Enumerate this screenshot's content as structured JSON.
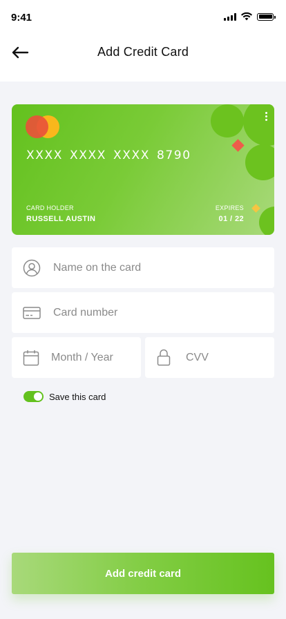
{
  "status_bar": {
    "time": "9:41"
  },
  "header": {
    "title": "Add Credit Card",
    "back_icon": "arrow-left-icon"
  },
  "card": {
    "number": "XXXX XXXX XXXX 8790",
    "holder_label": "CARD HOLDER",
    "holder_name": "RUSSELL AUSTIN",
    "expires_label": "EXPIRES",
    "expires_value": "01 / 22",
    "brand": "mastercard",
    "colors": {
      "gradient_start": "#63c11e",
      "gradient_end": "#a8d97a",
      "logo_red": "#e8533a",
      "logo_yellow": "#f9b71c"
    }
  },
  "form": {
    "name": {
      "placeholder": "Name on the card",
      "value": "",
      "icon": "user-icon"
    },
    "card_number": {
      "placeholder": "Card number",
      "value": "",
      "icon": "credit-card-icon"
    },
    "expiry": {
      "placeholder": "Month / Year",
      "value": "",
      "icon": "calendar-icon"
    },
    "cvv": {
      "placeholder": "CVV",
      "value": "",
      "icon": "lock-icon"
    }
  },
  "save_card": {
    "label": "Save this card",
    "enabled": true
  },
  "submit": {
    "label": "Add credit card"
  },
  "theme": {
    "accent": "#63c11e",
    "background": "#f3f4f8"
  }
}
